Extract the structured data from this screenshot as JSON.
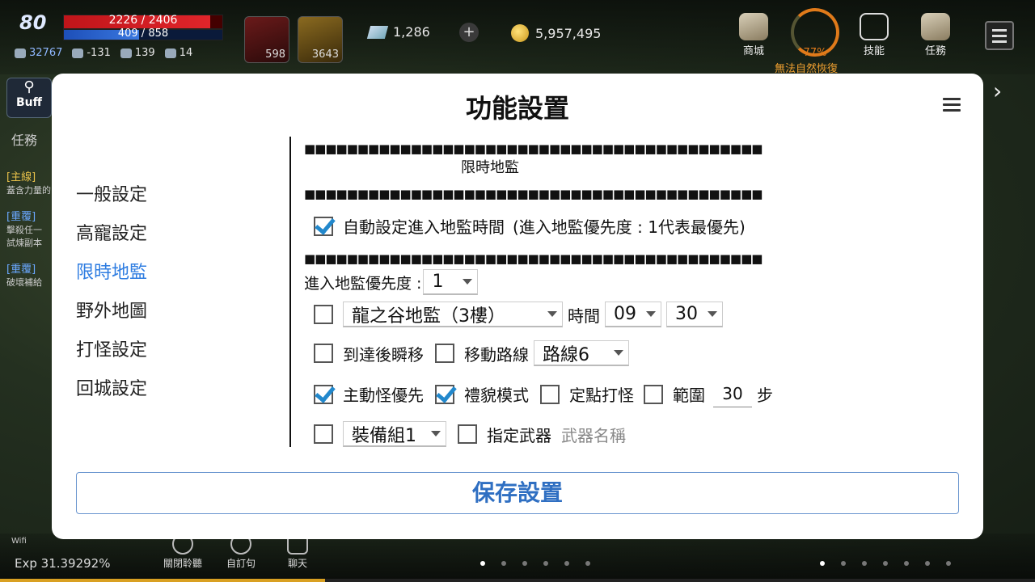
{
  "hud": {
    "level": "80",
    "hp_text": "2226 / 2406",
    "hp_ratio": 0.925,
    "mp_text": "409 / 858",
    "mp_ratio": 0.477,
    "stats": [
      "32767",
      "-131",
      "139",
      "14"
    ],
    "items": [
      {
        "count": "598"
      },
      {
        "count": "3643"
      }
    ],
    "gems": "1,286",
    "gold": "5,957,495",
    "plus": "+",
    "menus": [
      "商城",
      "技能",
      "任務"
    ],
    "gauge_value": "77%",
    "gauge_warning": "無法自然恢復",
    "buff_label": "Buff",
    "quest_tab": "任務",
    "quests": [
      {
        "tag": "[主線]",
        "sub": "蓋含力量的",
        "color": "#e8c14a"
      },
      {
        "tag": "[重覆]",
        "sub": "擊殺任一",
        "sub2": "試煉副本",
        "color": "#6aa8ff"
      },
      {
        "tag": "[重覆]",
        "sub": "破壞補給",
        "color": "#6aa8ff"
      }
    ],
    "exp": "Exp  31.39292%",
    "exp_ratio": 0.3139,
    "wifi": "Wifi",
    "bottom_buttons": [
      "關閉聆聽",
      "自訂句",
      "聊天"
    ]
  },
  "modal": {
    "title": "功能設置",
    "nav": [
      {
        "label": "一般設定",
        "active": false
      },
      {
        "label": "高寵設定",
        "active": false
      },
      {
        "label": "限時地監",
        "active": true
      },
      {
        "label": "野外地圖",
        "active": false
      },
      {
        "label": "打怪設定",
        "active": false
      },
      {
        "label": "回城設定",
        "active": false
      }
    ],
    "separator": "■■■■■■■■■■■■■■■■■■■■■■■■■■■■■■■■■■■■■■■■■■■",
    "section_title": "限時地監",
    "auto_time": {
      "checked": true,
      "label": "自動設定進入地監時間",
      "hint": "(進入地監優先度 : 1代表最優先)"
    },
    "priority_label": "進入地監優先度 :",
    "priority_value": "1",
    "dungeon": {
      "checked": false,
      "name": "龍之谷地監（3樓）",
      "time_label": "時間",
      "hour": "09",
      "minute": "30"
    },
    "teleport": {
      "checked": false,
      "label": "到達後瞬移"
    },
    "route": {
      "checked": false,
      "label": "移動路線",
      "value": "路線6"
    },
    "active_monster": {
      "checked": true,
      "label": "主動怪優先"
    },
    "polite_mode": {
      "checked": true,
      "label": "禮貌模式"
    },
    "fixed_point": {
      "checked": false,
      "label": "定點打怪"
    },
    "range": {
      "checked": false,
      "label": "範圍",
      "value": "30",
      "unit": "步"
    },
    "equip": {
      "checked": false,
      "value": "裝備組1"
    },
    "weapon": {
      "checked": false,
      "label": "指定武器",
      "placeholder": "武器名稱"
    },
    "save_label": "保存設置"
  }
}
